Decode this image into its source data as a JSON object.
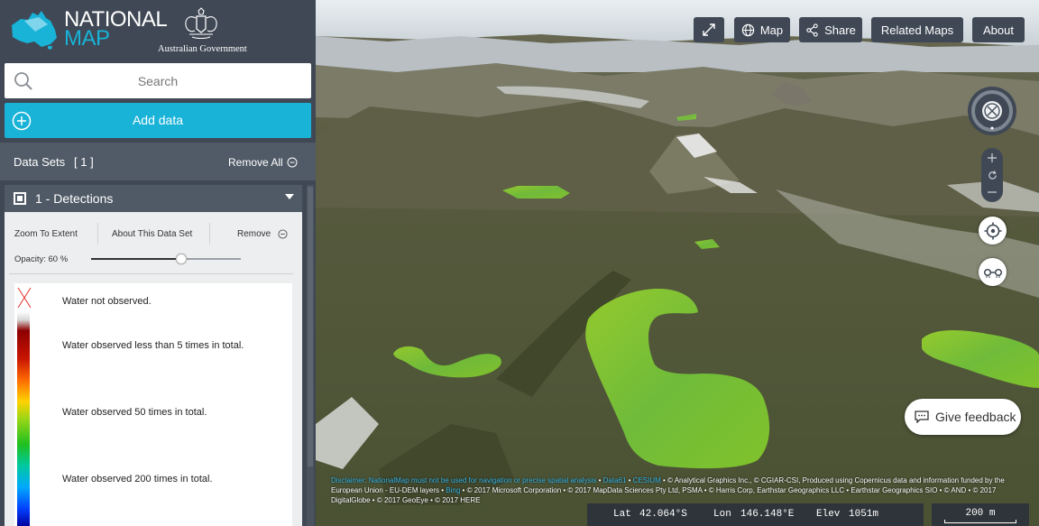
{
  "brand": {
    "line1": "NATIONAL",
    "line2": "MAP",
    "gov_name": "Australian Government",
    "accent": "#19b3d8"
  },
  "search": {
    "placeholder": "Search",
    "icon": "search-icon"
  },
  "add_data": {
    "label": "Add data",
    "icon": "plus-circle-icon"
  },
  "datasets": {
    "title": "Data Sets",
    "count": "[ 1 ]",
    "remove_all": "Remove All"
  },
  "dataset": {
    "title": "1 - Detections",
    "checked": true,
    "zoom_to_extent": "Zoom To Extent",
    "about": "About This Data Set",
    "remove": "Remove",
    "opacity_label": "Opacity: 60 %",
    "opacity": 0.6,
    "legend": [
      "Water not observed.",
      "Water observed less than 5 times in total.",
      "Water observed 50 times in total.",
      "Water observed 200 times in total."
    ]
  },
  "toolbar": {
    "fullscreen_icon": "expand-icon",
    "map": "Map",
    "share": "Share",
    "related_maps": "Related Maps",
    "about": "About"
  },
  "feedback": {
    "label": "Give feedback",
    "icon": "chat-icon"
  },
  "credits": {
    "disclaimer_link": "Disclaimer: NationalMap must not be used for navigation or precise spatial analysis",
    "data61": "Data61",
    "cesium": "CESIUM",
    "text1": "© Analytical Graphics Inc., © CGIAR-CSI, Produced using Copernicus data and information funded by the",
    "text2": "European Union - EU-DEM layers",
    "bing": "Bing",
    "text3": "© 2017 Microsoft Corporation • © 2017 MapData Sciences Pty Ltd, PSMA • © Harris Corp, Earthstar Geographics LLC • Earthstar Geographics SIO • © AND • © 2017",
    "text4": "DigitalGlobe • © 2017 GeoEye • © 2017 HERE"
  },
  "status": {
    "lat_label": "Lat",
    "lat": "42.064°S",
    "lon_label": "Lon",
    "lon": "146.148°E",
    "elev_label": "Elev",
    "elev": "1051m",
    "scale": "200 m"
  }
}
